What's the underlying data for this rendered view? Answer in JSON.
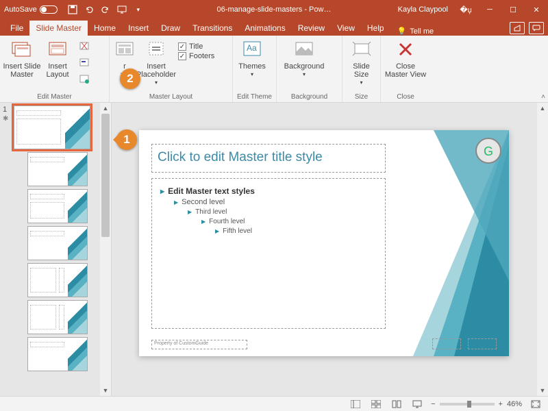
{
  "titlebar": {
    "autosave": "AutoSave",
    "doc": "06-manage-slide-masters  -  Pow…",
    "user": "Kayla Claypool"
  },
  "tabs": {
    "file": "File",
    "master": "Slide Master",
    "home": "Home",
    "insert": "Insert",
    "draw": "Draw",
    "trans": "Transitions",
    "anim": "Animations",
    "review": "Review",
    "view": "View",
    "help": "Help",
    "tell": "Tell me"
  },
  "ribbon": {
    "insertSlideMaster": "Insert Slide Master",
    "insertLayout": "Insert Layout",
    "editMaster": "Edit Master",
    "insertPh": "Insert Placeholder",
    "titleCk": "Title",
    "footersCk": "Footers",
    "masterLayout": "Master Layout",
    "themes": "Themes",
    "editTheme": "Edit Theme",
    "background": "Background",
    "backgroundLbl": "Background",
    "slideSize": "Slide Size",
    "size": "Size",
    "close": "Close Master View",
    "closeLbl": "Close"
  },
  "slide": {
    "title": "Click to edit Master title style",
    "l1": "Edit Master text styles",
    "l2": "Second level",
    "l3": "Third level",
    "l4": "Fourth level",
    "l5": "Fifth level",
    "footer": "Property of CustomGuide"
  },
  "thumbs": {
    "n1": "1"
  },
  "status": {
    "zoom": "46%"
  },
  "callout": {
    "c1": "1",
    "c2": "2"
  }
}
